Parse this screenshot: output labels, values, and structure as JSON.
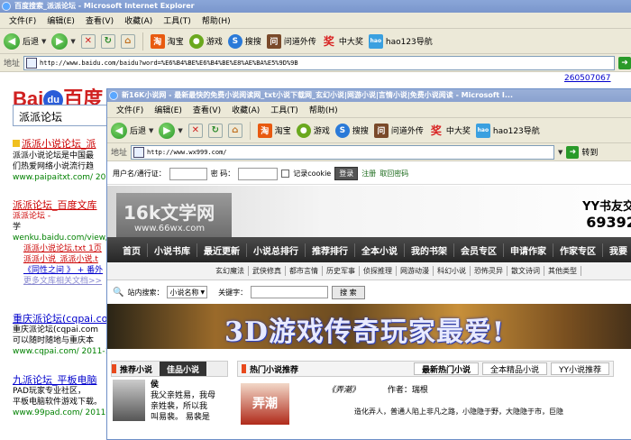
{
  "back_window": {
    "title": "百度搜索_派派论坛 - Microsoft Internet Explorer",
    "menu": [
      "文件(F)",
      "编辑(E)",
      "查看(V)",
      "收藏(A)",
      "工具(T)",
      "帮助(H)"
    ],
    "toolbar": {
      "back": "后退",
      "favorites": [
        {
          "icon": "taobao-icon",
          "label": "淘宝",
          "color": "#e85a10"
        },
        {
          "icon": "game-icon",
          "label": "游戏",
          "color": "#6aa81e"
        },
        {
          "icon": "sogou-icon",
          "label": "搜搜",
          "color": "#2a7ad8"
        },
        {
          "icon": "wenzhan-icon",
          "label": "问道外传",
          "color": "#7a4a2a"
        },
        {
          "icon": "lottery-icon",
          "label": "中大奖",
          "color": "#d82020"
        },
        {
          "icon": "hao123-icon",
          "label": "hao123导航",
          "color": "#3aa0e0"
        }
      ]
    },
    "address_label": "地址",
    "address": "http://www.baidu.com/baidu?word=%E6%B4%BE%E6%B4%BE%E8%AE%BA%E5%9D%9B",
    "baidu": {
      "logo_left": "Bai",
      "logo_paw": "du",
      "logo_right": "百度",
      "search_value": "派派论坛",
      "right_link": "260507067"
    },
    "results": [
      {
        "title": "派派小说论坛_派",
        "line1": "派派小说论坛是中国最",
        "line2": "们热爱网络小说流行趋",
        "url": "www.paipaitxt.com/ 2011-"
      },
      {
        "title": "派派论坛_百度文库",
        "line1": "派派论坛 -",
        "line2": "学",
        "url": "wenku.baidu.com/view/0",
        "links": [
          "派派小说论坛.txt 1页",
          "派派小说_派派小说.t",
          "《同性之间 》 + 番外",
          "更多文库相关文档>>"
        ]
      },
      {
        "title": "重庆派论坛(cqpai.com",
        "line1": "重庆派论坛(cqpai.com",
        "line2": "可以随时随地与重庆本",
        "url": "www.cqpai.com/ 2011-1"
      },
      {
        "title": "九派论坛_平板电脑",
        "line1": "PAD玩家专业社区，",
        "line2": "平板电脑软件游戏下载。",
        "url": "www.99pad.com/ 2011-"
      }
    ]
  },
  "front_window": {
    "title": "新16K小说网 - 最新最快的免费小说阅读网_txt小说下载网_玄幻小说|网游小说|言情小说|免费小说阅读 - Microsoft I...",
    "menu": [
      "文件(F)",
      "编辑(E)",
      "查看(V)",
      "收藏(A)",
      "工具(T)",
      "帮助(H)"
    ],
    "toolbar": {
      "back": "后退",
      "favorites": [
        {
          "icon": "taobao-icon",
          "label": "淘宝",
          "color": "#e85a10"
        },
        {
          "icon": "game-icon",
          "label": "游戏",
          "color": "#6aa81e"
        },
        {
          "icon": "sogou-icon",
          "label": "搜搜",
          "color": "#2a7ad8"
        },
        {
          "icon": "wenzhan-icon",
          "label": "问道外传",
          "color": "#7a4a2a"
        },
        {
          "icon": "lottery-icon",
          "label": "中大奖",
          "color": "#d82020"
        },
        {
          "icon": "hao123-icon",
          "label": "hao123导航",
          "color": "#3aa0e0"
        }
      ]
    },
    "address_label": "地址",
    "address": "http://www.wx999.com/",
    "go_label": "转到",
    "login": {
      "user_label": "用户名/通行证：",
      "pass_label": "密 码：",
      "remember": "记录cookie",
      "login_btn": "登录",
      "register": "注册",
      "retrieve": "取回密码"
    },
    "logo": {
      "name": "16k文学网",
      "url": "www.66wx.com"
    },
    "slogan": {
      "line1": "YY书友交流",
      "line2": "693929"
    },
    "main_nav": [
      "首页",
      "小说书库",
      "最近更新",
      "小说总排行",
      "推荐排行",
      "全本小说",
      "我的书架",
      "会员专区",
      "申请作家",
      "作家专区",
      "我要"
    ],
    "sub_nav": [
      "玄幻魔法",
      "武侠修真",
      "都市言情",
      "历史军事",
      "侦探推理",
      "网游动漫",
      "科幻小说",
      "恐怖灵异",
      "散文诗词",
      "其他类型"
    ],
    "site_search": {
      "label": "站内搜索：",
      "select": "小说名称",
      "keyword_label": "关键字：",
      "button": "搜 索"
    },
    "ad_text": "3D游戏传奇玩家最爱!",
    "panels": {
      "left_tabs": [
        "推荐小说",
        "佳品小说"
      ],
      "left_book": {
        "title": "侯",
        "text1": "我父亲姓易，我母",
        "text2": "亲姓裴，所以我",
        "text3": "叫易裴。 易裴是"
      },
      "mid_title": "热门小说推荐",
      "mid_tabs": [
        "最新热门小说",
        "全本精品小说",
        "YY小说推荐"
      ],
      "mid_book": {
        "name": "《弄潮》",
        "author_label": "作者：",
        "author": "瑞根",
        "text": "造化弄人，普通人陷上非凡之路，小隐隐于野，大隐隐于市，巨隐",
        "cover": "弄潮"
      }
    }
  }
}
